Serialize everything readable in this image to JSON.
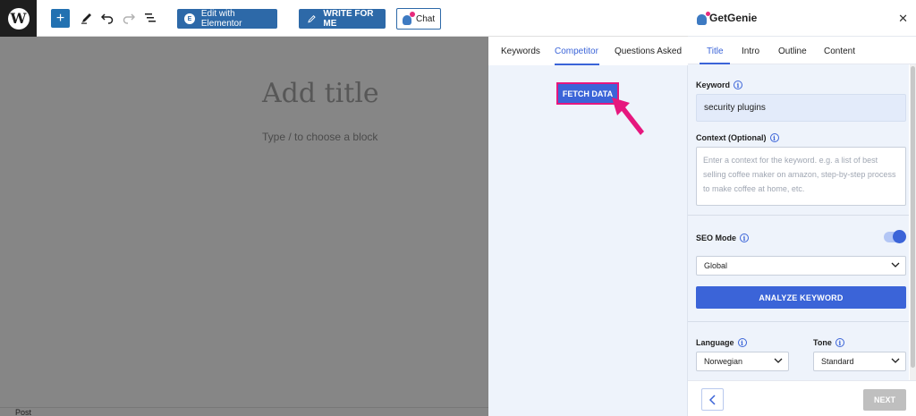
{
  "toolbar": {
    "add_icon": "plus-icon",
    "edit_with_elementor": "Edit with Elementor",
    "write_for_me": "WRITE FOR ME",
    "chat": "Chat"
  },
  "editor": {
    "title_placeholder": "Add title",
    "block_placeholder": "Type / to choose a block",
    "status_label": "Post"
  },
  "middle_panel": {
    "tabs": [
      {
        "label": "Keywords",
        "active": false
      },
      {
        "label": "Competitor",
        "active": true
      },
      {
        "label": "Questions Asked",
        "active": false
      }
    ],
    "fetch_button": "FETCH DATA",
    "highlight_color": "#e6177e"
  },
  "getgenie": {
    "brand": "GetGenie",
    "tabs": [
      {
        "label": "Title",
        "active": true
      },
      {
        "label": "Intro",
        "active": false
      },
      {
        "label": "Outline",
        "active": false
      },
      {
        "label": "Content",
        "active": false
      }
    ],
    "keyword": {
      "label": "Keyword",
      "value": "security plugins"
    },
    "context": {
      "label": "Context (Optional)",
      "placeholder": "Enter a context for the keyword. e.g. a list of best selling coffee maker on amazon, step-by-step process to make coffee at home, etc."
    },
    "seo_mode": {
      "label": "SEO Mode",
      "enabled": true,
      "selected": "Global"
    },
    "analyze_button": "ANALYZE KEYWORD",
    "language": {
      "label": "Language",
      "selected": "Norwegian"
    },
    "tone": {
      "label": "Tone",
      "selected": "Standard"
    },
    "next_button": "NEXT",
    "accent_color": "#3b64d8"
  }
}
